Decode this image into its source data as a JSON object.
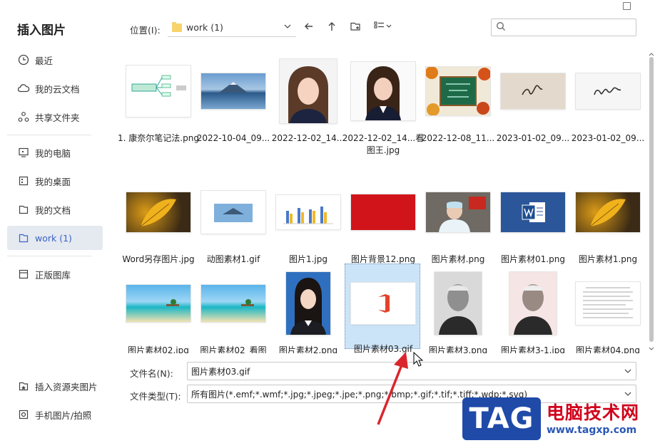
{
  "dialog": {
    "title": "插入图片"
  },
  "sidebar": {
    "items": [
      {
        "label": "最近",
        "icon": "clock-icon"
      },
      {
        "label": "我的云文档",
        "icon": "cloud-icon"
      },
      {
        "label": "共享文件夹",
        "icon": "share-icon"
      },
      {
        "label": "我的电脑",
        "icon": "monitor-icon"
      },
      {
        "label": "我的桌面",
        "icon": "desktop-icon"
      },
      {
        "label": "我的文档",
        "icon": "document-icon"
      },
      {
        "label": "work (1)",
        "icon": "folder-icon",
        "active": true
      },
      {
        "label": "正版图库",
        "icon": "gallery-icon"
      },
      {
        "label": "插入资源夹图片",
        "icon": "resource-folder-icon"
      },
      {
        "label": "手机图片/拍照",
        "icon": "phone-icon"
      }
    ]
  },
  "toolbar": {
    "location_label": "位置(I):",
    "location_value": "work (1)",
    "search_placeholder": ""
  },
  "files": [
    {
      "name": "1. 康奈尔笔记法.png",
      "selected": false
    },
    {
      "name": "2022-10-04_09...",
      "selected": false
    },
    {
      "name": "2022-12-02_14...",
      "selected": false
    },
    {
      "name": "2022-12-02_14...看图王.jpg",
      "selected": false
    },
    {
      "name": "2022-12-08_11...",
      "selected": false
    },
    {
      "name": "2023-01-02_09...",
      "selected": false
    },
    {
      "name": "2023-01-02_09...",
      "selected": false
    },
    {
      "name": "Word另存图片.jpg",
      "selected": false
    },
    {
      "name": "动图素材1.gif",
      "selected": false
    },
    {
      "name": "图片1.jpg",
      "selected": false
    },
    {
      "name": "图片背景12.png",
      "selected": false
    },
    {
      "name": "图片素材.png",
      "selected": false
    },
    {
      "name": "图片素材01.png",
      "selected": false
    },
    {
      "name": "图片素材1.png",
      "selected": false
    },
    {
      "name": "图片素材02.jpg",
      "selected": false
    },
    {
      "name": "图片素材02_看图",
      "selected": false
    },
    {
      "name": "图片素材2.png",
      "selected": false
    },
    {
      "name": "图片素材03.gif",
      "selected": true
    },
    {
      "name": "图片素材3.png",
      "selected": false
    },
    {
      "name": "图片素材3-1.jpg",
      "selected": false
    },
    {
      "name": "图片素材04.png",
      "selected": false
    }
  ],
  "form": {
    "filename_label": "文件名(N):",
    "filename_value": "图片素材03.gif",
    "filetype_label": "文件类型(T):",
    "filetype_value": "所有图片(*.emf;*.wmf;*.jpg;*.jpeg;*.jpe;*.png;*.bmp;*.gif;*.tif;*.tiff;*.wdp;*.svg)"
  },
  "watermark": {
    "logo": "TAG",
    "title": "电脑技术网",
    "url": "www.tagxp.com"
  },
  "colors": {
    "accent": "#3a63c8",
    "selection": "#cce4f7",
    "arrow": "#d9262c"
  }
}
